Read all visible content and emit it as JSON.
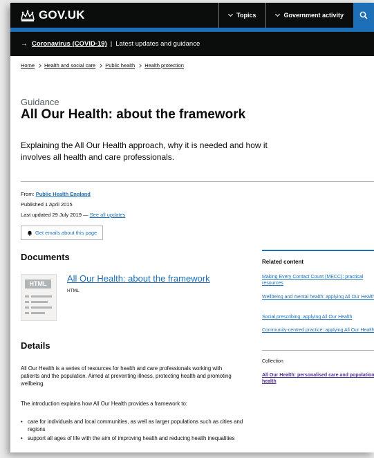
{
  "header": {
    "logo_text": "GOV.UK",
    "nav": [
      "Topics",
      "Government activity"
    ],
    "search_icon": "search-icon"
  },
  "covid_banner": {
    "link": "Coronavirus (COVID-19)",
    "sep": "|",
    "text": "Latest updates and guidance"
  },
  "breadcrumbs": [
    "Home",
    "Health and social care",
    "Public health",
    "Health protection"
  ],
  "caption": "Guidance",
  "title": "All Our Health: about the framework",
  "lead": "Explaining the All Our Health approach, why it is needed and how it involves all health and care professionals.",
  "meta": {
    "from_label": "From:",
    "from_org": "Public Health England",
    "published": "Published 1 April 2015",
    "updated": "Last updated 29 July 2019 —",
    "see_all": "See all updates"
  },
  "email_button": "Get emails about this page",
  "documents": {
    "heading": "Documents",
    "thumb_tag": "HTML",
    "link": "All Our Health: about the framework",
    "type": "HTML"
  },
  "details": {
    "heading": "Details",
    "para1": "All Our Health is a series of resources for health and care professionals working with patients and the population. Aimed at preventing illness, protecting health and promoting wellbeing.",
    "para2": "The introduction explains how All Our Health provides a framework to:",
    "bullets": [
      "care for individuals and local communities, as well as larger populations such as cities and regions",
      "support all ages of life with the aim of improving health and reducing health inequalities"
    ]
  },
  "related": {
    "heading": "Related content",
    "links": [
      "Making Every Contact Count (MECC): practical resources",
      "Wellbeing and mental health: applying All Our Health",
      "Social prescribing: applying All Our Health",
      "Community-centred practice: applying All Our Health"
    ],
    "collection_label": "Collection",
    "collection_link": "All Our Health: personalised care and population health"
  }
}
